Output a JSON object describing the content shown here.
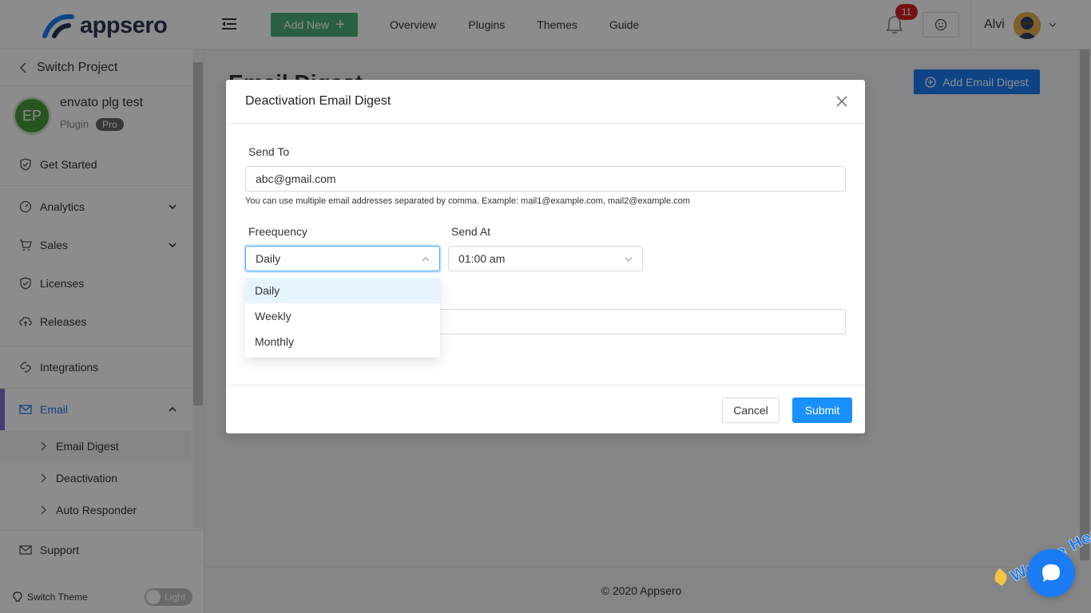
{
  "header": {
    "logo_text": "appsero",
    "add_new_label": "Add New",
    "nav": [
      "Overview",
      "Plugins",
      "Themes",
      "Guide"
    ],
    "notification_count": "11",
    "user_name": "Alvi"
  },
  "sidebar": {
    "switch_project": "Switch Project",
    "project": {
      "initials": "EP",
      "name": "envato plg test",
      "type": "Plugin",
      "badge": "Pro"
    },
    "items": [
      {
        "label": "Get Started",
        "icon": "shield-check-icon"
      },
      {
        "label": "Analytics",
        "icon": "dashboard-icon"
      },
      {
        "label": "Sales",
        "icon": "cart-icon"
      },
      {
        "label": "Licenses",
        "icon": "license-icon"
      },
      {
        "label": "Releases",
        "icon": "cloud-upload-icon"
      },
      {
        "label": "Integrations",
        "icon": "link-icon"
      },
      {
        "label": "Email",
        "icon": "mail-icon"
      }
    ],
    "email_sub": [
      "Email Digest",
      "Deactivation",
      "Auto Responder"
    ],
    "support": "Support",
    "switch_theme": "Switch Theme",
    "theme_toggle": "Light"
  },
  "main": {
    "page_title": "Email Digest",
    "add_digest_label": "Add Email Digest",
    "footer": "© 2020 Appsero"
  },
  "modal": {
    "title": "Deactivation Email Digest",
    "send_to_label": "Send To",
    "send_to_value": "abc@gmail.com",
    "hint": "You can use multiple email addresses separated by comma. Example: mail1@example.com, mail2@example.com",
    "frequency_label": "Freequency",
    "frequency_value": "Daily",
    "send_at_label": "Send At",
    "send_at_value": "01:00 am",
    "frequency_options": [
      "Daily",
      "Weekly",
      "Monthly"
    ],
    "cancel_label": "Cancel",
    "submit_label": "Submit"
  },
  "chat_widget": {
    "label": "We Are Here!"
  },
  "colors": {
    "primary": "#1a7cf5",
    "add_new": "#4caf7a",
    "badge": "#d32121",
    "active_bar": "#7e6ed6"
  }
}
